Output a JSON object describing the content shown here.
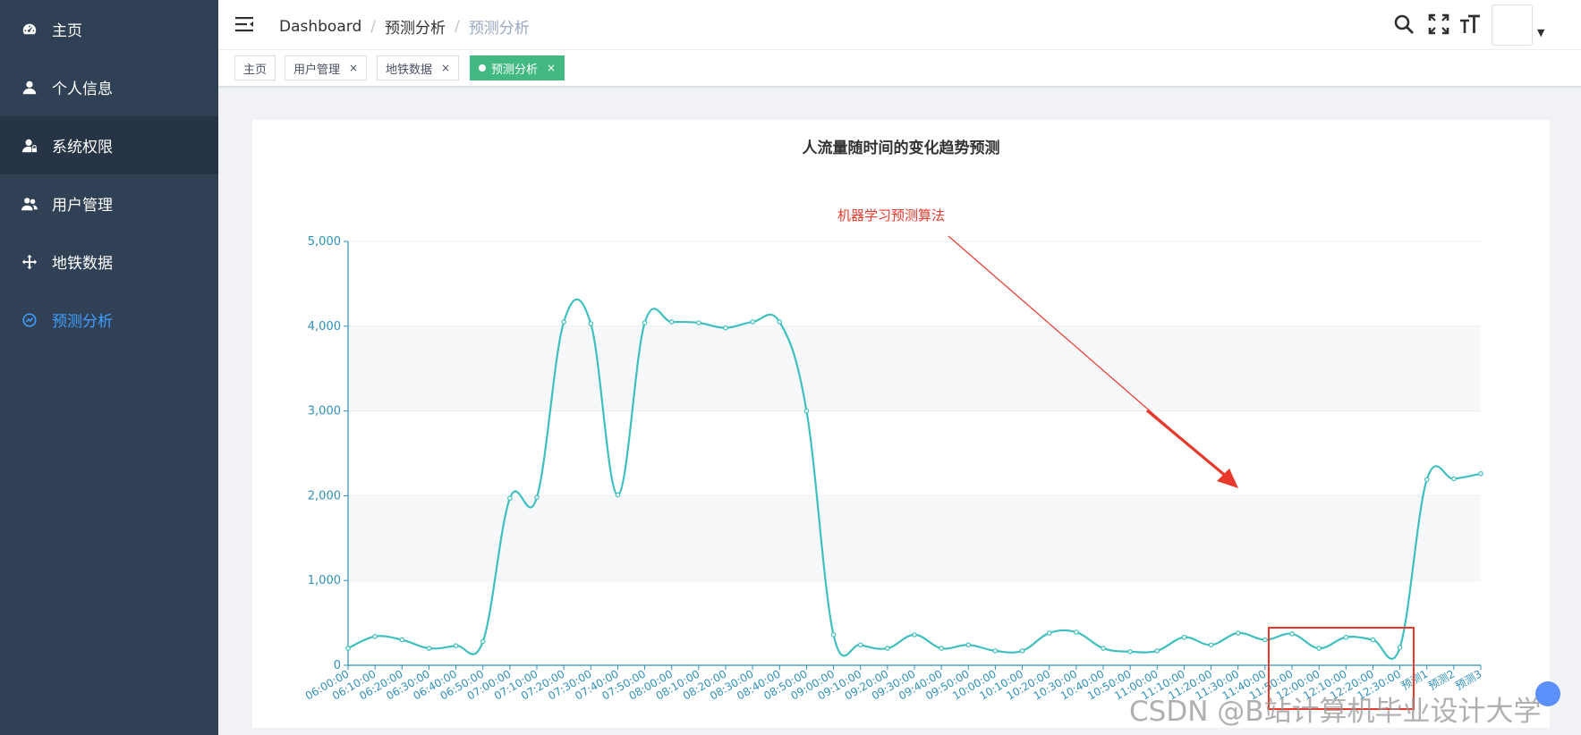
{
  "sidebar": {
    "items": [
      {
        "label": "主页",
        "icon": "dashboard-icon"
      },
      {
        "label": "个人信息",
        "icon": "user-icon"
      },
      {
        "label": "系统权限",
        "icon": "user-lock-icon"
      },
      {
        "label": "用户管理",
        "icon": "users-icon"
      },
      {
        "label": "地铁数据",
        "icon": "move-icon"
      },
      {
        "label": "预测分析",
        "icon": "chart-gauge-icon"
      }
    ],
    "active_index": 5
  },
  "navbar": {
    "breadcrumb": [
      "Dashboard",
      "预测分析",
      "预测分析"
    ]
  },
  "tags": [
    {
      "label": "主页",
      "closable": false,
      "active": false
    },
    {
      "label": "用户管理",
      "closable": true,
      "active": false
    },
    {
      "label": "地铁数据",
      "closable": true,
      "active": false
    },
    {
      "label": "预测分析",
      "closable": true,
      "active": true
    }
  ],
  "tag_close_glyph": "×",
  "annotation": "机器学习预测算法",
  "watermark": "CSDN @B站计算机毕业设计大学",
  "colors": {
    "sidebar_bg": "#304156",
    "active_text": "#409eff",
    "active_tag": "#42b983",
    "line": "#3fbfbf",
    "axis": "#3090b8",
    "annotation": "#e8392c"
  },
  "chart_data": {
    "type": "line",
    "title": "人流量随时间的变化趋势预测",
    "xlabel": "",
    "ylabel": "",
    "ylim": [
      0,
      5000
    ],
    "yticks": [
      0,
      1000,
      2000,
      3000,
      4000,
      5000
    ],
    "ytick_labels": [
      "0",
      "1,000",
      "2,000",
      "3,000",
      "4,000",
      "5,000"
    ],
    "grid": "alternating horizontal bands",
    "categories": [
      "06:00:00",
      "06:10:00",
      "06:20:00",
      "06:30:00",
      "06:40:00",
      "06:50:00",
      "07:00:00",
      "07:10:00",
      "07:20:00",
      "07:30:00",
      "07:40:00",
      "07:50:00",
      "08:00:00",
      "08:10:00",
      "08:20:00",
      "08:30:00",
      "08:40:00",
      "08:50:00",
      "09:00:00",
      "09:10:00",
      "09:20:00",
      "09:30:00",
      "09:40:00",
      "09:50:00",
      "10:00:00",
      "10:10:00",
      "10:20:00",
      "10:30:00",
      "10:40:00",
      "10:50:00",
      "11:00:00",
      "11:10:00",
      "11:20:00",
      "11:30:00",
      "11:40:00",
      "11:50:00",
      "12:00:00",
      "12:10:00",
      "12:20:00",
      "12:30:00",
      "预测1",
      "预测2",
      "预测3"
    ],
    "values": [
      200,
      340,
      300,
      200,
      230,
      280,
      1970,
      1980,
      4050,
      4030,
      2010,
      4040,
      4050,
      4040,
      3980,
      4050,
      4050,
      3000,
      360,
      240,
      200,
      360,
      200,
      240,
      170,
      170,
      380,
      390,
      200,
      160,
      170,
      330,
      240,
      380,
      300,
      370,
      200,
      330,
      300,
      210,
      2190,
      2200,
      2260
    ]
  }
}
